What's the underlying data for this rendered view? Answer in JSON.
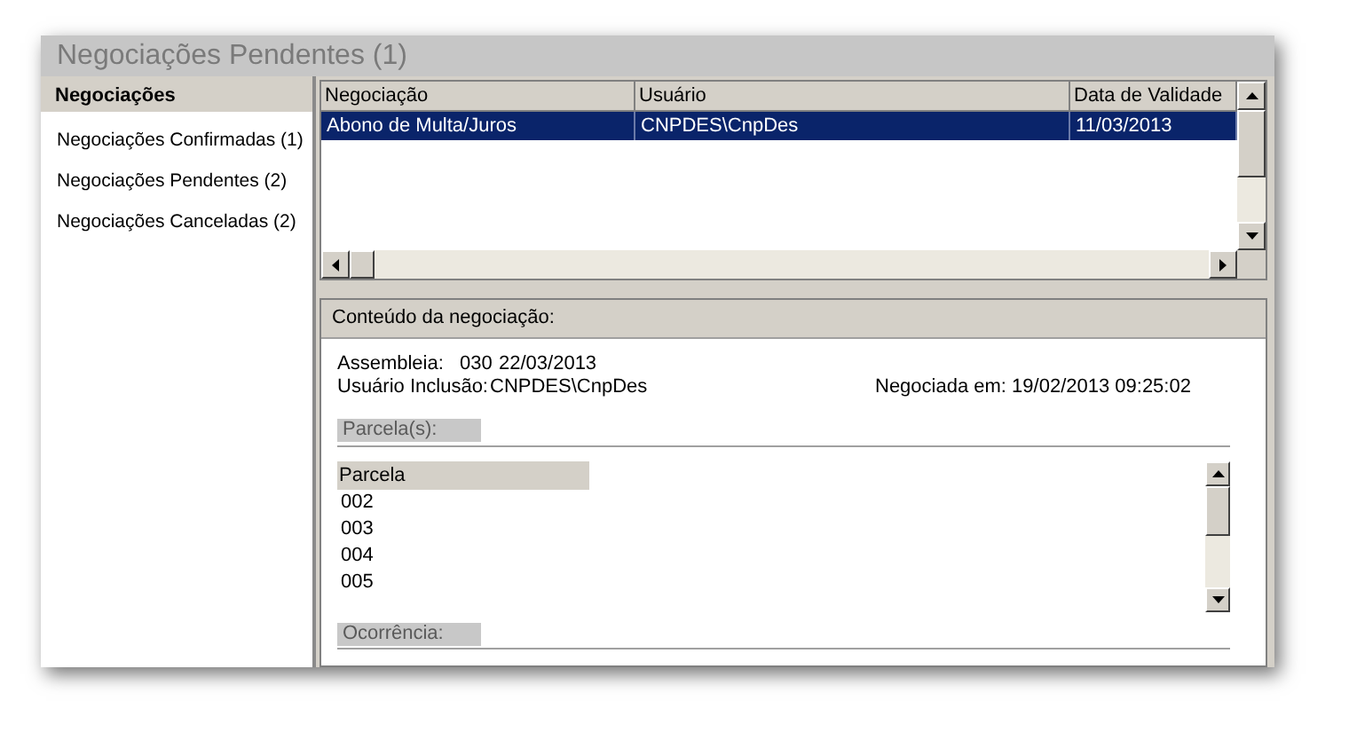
{
  "window": {
    "title": "Negociações Pendentes (1)"
  },
  "sidebar": {
    "header": "Negociações",
    "items": [
      {
        "label": "Negociações Confirmadas (1)"
      },
      {
        "label": "Negociações Pendentes (2)"
      },
      {
        "label": "Negociações Canceladas (2)"
      }
    ]
  },
  "grid": {
    "columns": [
      "Negociação",
      "Usuário",
      "Data de Validade"
    ],
    "rows": [
      {
        "cells": [
          "Abono de Multa/Juros",
          "CNPDES\\CnpDes",
          "11/03/2013"
        ],
        "selected": true
      }
    ]
  },
  "details": {
    "header": "Conteúdo da negociação:",
    "assembleia_label": "Assembleia:",
    "assembleia_number": "030",
    "assembleia_date": "22/03/2013",
    "user_label": "Usuário Inclusão:",
    "user": "CNPDES\\CnpDes",
    "negotiated": "Negociada em: 19/02/2013 09:25:02",
    "installments": {
      "label": "Parcela(s):",
      "column": "Parcela",
      "rows": [
        "002",
        "003",
        "004",
        "005"
      ]
    },
    "occurrence": {
      "label": "Ocorrência:"
    }
  }
}
